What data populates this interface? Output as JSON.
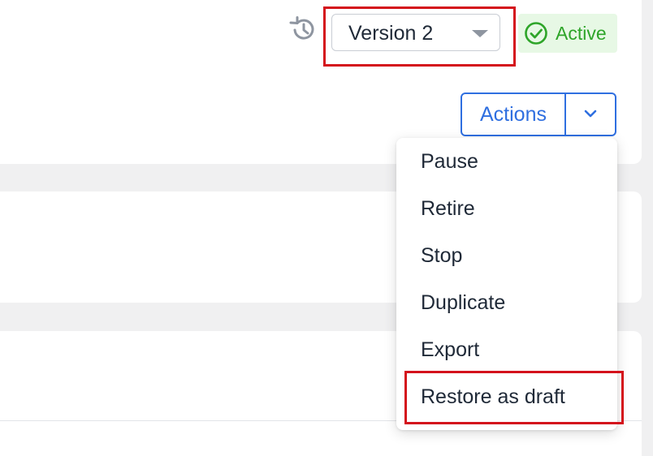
{
  "header": {
    "version_select": {
      "value": "Version 2"
    },
    "status_badge": {
      "label": "Active",
      "color": "#2ea529",
      "background": "#e7f8e5"
    }
  },
  "actions": {
    "label": "Actions",
    "accent_color": "#2f6fe0",
    "menu_items": [
      {
        "label": "Pause"
      },
      {
        "label": "Retire"
      },
      {
        "label": "Stop"
      },
      {
        "label": "Duplicate"
      },
      {
        "label": "Export"
      },
      {
        "label": "Restore as draft"
      }
    ]
  },
  "icons": {
    "history": "history-icon",
    "dropdown_caret": "caret-down-icon",
    "status_check": "check-circle-icon",
    "actions_chevron": "chevron-down-icon"
  },
  "highlight_color": "#d4121c"
}
